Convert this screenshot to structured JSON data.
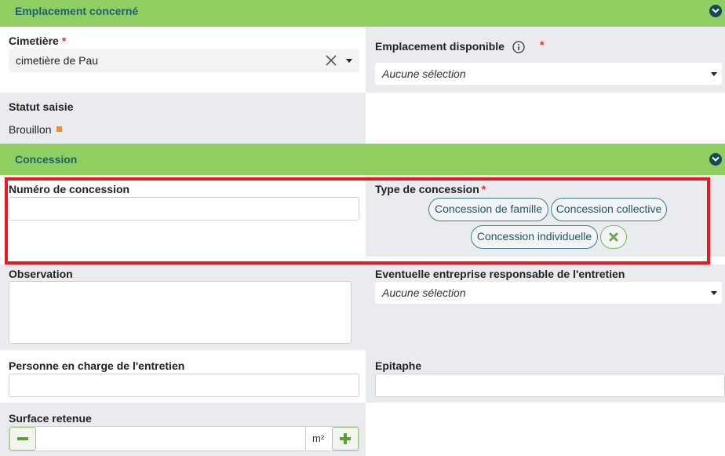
{
  "sections": {
    "emplacement": {
      "title": "Emplacement concerné"
    },
    "concession": {
      "title": "Concession"
    }
  },
  "fields": {
    "cimetiere": {
      "label": "Cimetière",
      "required": "*",
      "value": "cimetière de Pau"
    },
    "emplacement_disponible": {
      "label": "Emplacement disponible",
      "required": "*",
      "value": "Aucune sélection"
    },
    "statut_saisie": {
      "label": "Statut saisie",
      "value": "Brouillon"
    },
    "numero_concession": {
      "label": "Numéro de concession",
      "value": ""
    },
    "type_concession": {
      "label": "Type de concession",
      "required": "*",
      "options": [
        "Concession de famille",
        "Concession collective",
        "Concession individuelle"
      ]
    },
    "observation": {
      "label": "Observation",
      "value": ""
    },
    "entreprise_entretien": {
      "label": "Eventuelle entreprise responsable de l'entretien",
      "value": "Aucune sélection"
    },
    "personne_entretien": {
      "label": "Personne en charge de l'entretien",
      "value": ""
    },
    "epitaphe": {
      "label": "Epitaphe",
      "value": ""
    },
    "surface_retenue": {
      "label": "Surface retenue",
      "value": "",
      "unit": "m²"
    }
  },
  "colors": {
    "section_header": "#8fcf62",
    "section_title": "#1f5f70",
    "required": "#d9322e",
    "status_draft": "#f08a33",
    "highlight_box": "#e31b23",
    "chip_border": "#3b7e90"
  },
  "icons": {
    "section_toggle": "chevron-down-icon",
    "clear": "clear-x-icon",
    "info": "info-icon",
    "minus": "minus-icon",
    "plus": "plus-icon"
  }
}
